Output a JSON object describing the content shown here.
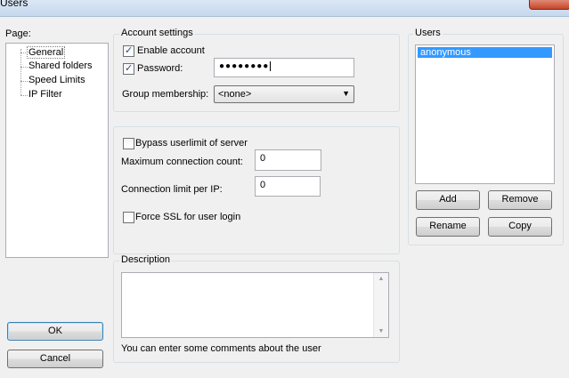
{
  "window": {
    "title": "Users"
  },
  "page_panel": {
    "label": "Page:",
    "items": [
      "General",
      "Shared folders",
      "Speed Limits",
      "IP Filter"
    ],
    "selected": "General"
  },
  "account_settings": {
    "label": "Account settings",
    "enable_account": {
      "label": "Enable account",
      "checked": true
    },
    "password": {
      "label": "Password:",
      "checked": true,
      "value": "●●●●●●●●"
    },
    "group_membership": {
      "label": "Group membership:",
      "value": "<none>"
    }
  },
  "limits": {
    "bypass": {
      "label": "Bypass userlimit of server",
      "checked": false
    },
    "max_connections": {
      "label": "Maximum connection count:",
      "value": "0"
    },
    "limit_per_ip": {
      "label": "Connection limit per IP:",
      "value": "0"
    },
    "force_ssl": {
      "label": "Force SSL for user login",
      "checked": false
    }
  },
  "description": {
    "label": "Description",
    "value": "",
    "hint": "You can enter some comments about the user"
  },
  "users": {
    "label": "Users",
    "list": [
      "anonymous"
    ],
    "selected": "anonymous",
    "buttons": {
      "add": "Add",
      "remove": "Remove",
      "rename": "Rename",
      "copy": "Copy"
    }
  },
  "dialog_buttons": {
    "ok": "OK",
    "cancel": "Cancel"
  },
  "colors": {
    "selection": "#3399ff",
    "default_button_border": "#3c7fb1"
  }
}
